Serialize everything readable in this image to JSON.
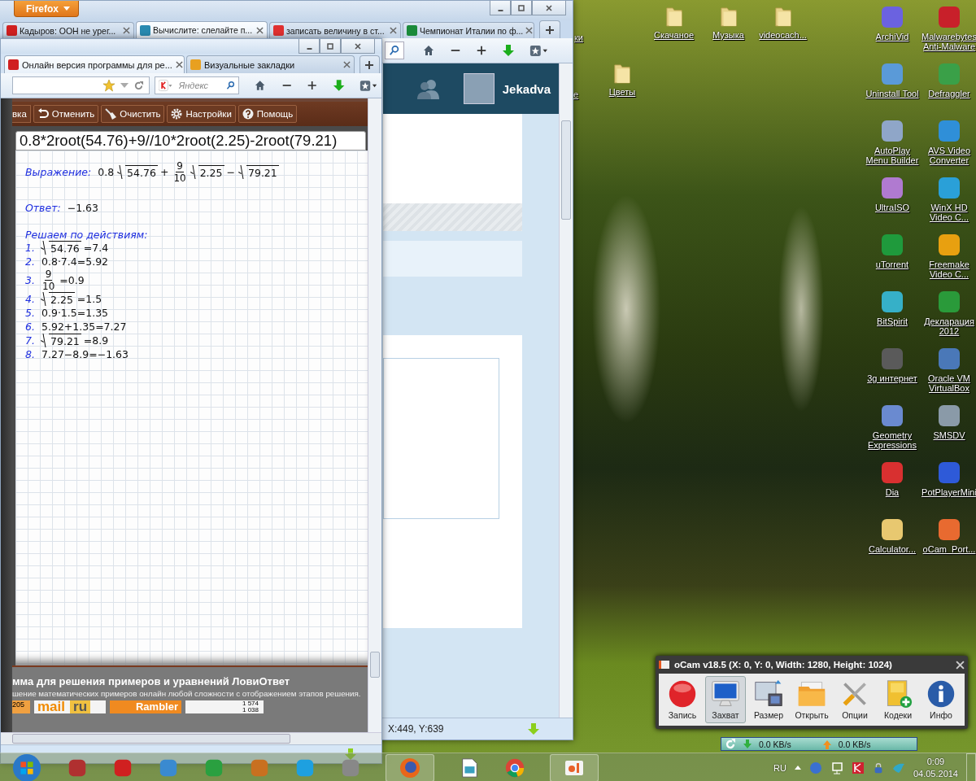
{
  "desktop": {
    "partial_labels": [
      "ки",
      "е"
    ],
    "folders": [
      {
        "label": "Скачаное"
      },
      {
        "label": "Музыка"
      },
      {
        "label": "videocach..."
      },
      {
        "label": "Цветы"
      }
    ],
    "shortcuts": [
      {
        "label": "ArchiVid",
        "color": "#6b62e0"
      },
      {
        "label": "Malwarebytes Anti-Malware",
        "color": "#c8202a"
      },
      {
        "label": "Uninstall Tool",
        "color": "#5a9ad8"
      },
      {
        "label": "Defraggler",
        "color": "#3aa048"
      },
      {
        "label": "AutoPlay Menu Builder",
        "color": "#8fa6c8"
      },
      {
        "label": "AVS Video Converter",
        "color": "#2f8fd8"
      },
      {
        "label": "UltraISO",
        "color": "#b07ad0"
      },
      {
        "label": "WinX HD Video C...",
        "color": "#2aa0d8"
      },
      {
        "label": "uTorrent",
        "color": "#1f9a3c"
      },
      {
        "label": "Freemake Video C...",
        "color": "#e8a010"
      },
      {
        "label": "BitSpirit",
        "color": "#36b0c8"
      },
      {
        "label": "Декларация 2012",
        "color": "#2a9a3a"
      },
      {
        "label": "3g интернет",
        "color": "#5a5a5a"
      },
      {
        "label": "Oracle VM VirtualBox",
        "color": "#4a78b8"
      },
      {
        "label": "Geometry Expressions",
        "color": "#6a8ad0"
      },
      {
        "label": "SMSDV",
        "color": "#8a9aa8"
      },
      {
        "label": "Dia",
        "color": "#d83030"
      },
      {
        "label": "PotPlayerMini",
        "color": "#2e5ad8"
      },
      {
        "label": "Calculator...",
        "color": "#e8c870"
      },
      {
        "label": "oCam_Port...",
        "color": "#e86a30"
      }
    ]
  },
  "back_window": {
    "menu_button": "Firefox",
    "tabs": [
      {
        "title": "Кадыров: ООН не урег...",
        "selected": false
      },
      {
        "title": "Вычислите: слелайте п...",
        "selected": true
      },
      {
        "title": "записать величину в ст...",
        "selected": false
      },
      {
        "title": "Чемпионат Италии по ф...",
        "selected": false
      }
    ],
    "page": {
      "username": "Jekadva"
    },
    "status": "X:449, Y:639"
  },
  "front_window": {
    "tabs": [
      {
        "title": "Онлайн версия программы для ре...",
        "selected": true
      },
      {
        "title": "Визуальные закладки",
        "selected": false
      }
    ],
    "search": {
      "placeholder": "Яндекс"
    },
    "toolbar": [
      {
        "label": "вка",
        "kind": "plain"
      },
      {
        "label": "Отменить",
        "kind": "undo"
      },
      {
        "label": "Очистить",
        "kind": "clear"
      },
      {
        "label": "Настройки",
        "kind": "settings"
      },
      {
        "label": "Помощь",
        "kind": "help"
      }
    ],
    "input": "0.8*2root(54.76)+9//10*2root(2.25)-2root(79.21)",
    "solution": {
      "expression_label": "Выражение:",
      "expression": [
        {
          "kind": "text",
          "text": "0.8"
        },
        {
          "kind": "sqrt",
          "text": "54.76"
        },
        {
          "kind": "text",
          "text": "+"
        },
        {
          "kind": "frac",
          "num": "9",
          "den": "10"
        },
        {
          "kind": "sqrt",
          "text": "2.25"
        },
        {
          "kind": "text",
          "text": "−"
        },
        {
          "kind": "sqrt",
          "text": "79.21"
        }
      ],
      "answer_label": "Ответ:",
      "answer": [
        {
          "kind": "text",
          "text": "−1.63"
        }
      ],
      "steps_label": "Решаем по действиям:",
      "steps": [
        {
          "number": "1.",
          "formula": [
            {
              "kind": "sqrt",
              "text": "54.76"
            },
            {
              "kind": "text",
              "text": "=7.4"
            }
          ]
        },
        {
          "number": "2.",
          "formula": [
            {
              "kind": "text",
              "text": "0.8·7.4=5.92"
            }
          ]
        },
        {
          "number": "3.",
          "formula": [
            {
              "kind": "frac",
              "num": "9",
              "den": "10"
            },
            {
              "kind": "text",
              "text": "=0.9"
            }
          ]
        },
        {
          "number": "4.",
          "formula": [
            {
              "kind": "sqrt",
              "text": "2.25"
            },
            {
              "kind": "text",
              "text": "=1.5"
            }
          ]
        },
        {
          "number": "5.",
          "formula": [
            {
              "kind": "text",
              "text": "0.9·1.5=1.35"
            }
          ]
        },
        {
          "number": "6.",
          "formula": [
            {
              "kind": "text",
              "text": "5.92+1.35=7.27"
            }
          ]
        },
        {
          "number": "7.",
          "formula": [
            {
              "kind": "sqrt",
              "text": "79.21"
            },
            {
              "kind": "text",
              "text": "=8.9"
            }
          ]
        },
        {
          "number": "8.",
          "formula": [
            {
              "kind": "text",
              "text": "7.27−8.9=−1.63"
            }
          ]
        }
      ]
    },
    "footer": {
      "title": "мма для решения примеров и уравнений ЛовиОтвет",
      "subtitle": "шение математических примеров онлайн любой сложности с отображением этапов решения.",
      "banners": [
        {
          "kind": "counter",
          "texts": [
            "205"
          ]
        },
        {
          "kind": "mail",
          "texts": [
            "mail",
            "ru"
          ]
        },
        {
          "kind": "rambler",
          "texts": [
            "Rambler"
          ]
        },
        {
          "kind": "stats",
          "texts": [
            "1 574",
            "1 038"
          ]
        }
      ]
    }
  },
  "ocam": {
    "title": "oCam v18.5 (X: 0, Y: 0, Width: 1280, Height: 1024)",
    "buttons": [
      {
        "label": "Запись",
        "kind": "record",
        "selected": false
      },
      {
        "label": "Захват",
        "kind": "capture",
        "selected": true
      },
      {
        "label": "Размер",
        "kind": "resize",
        "selected": false
      },
      {
        "label": "Открыть",
        "kind": "open",
        "selected": false
      },
      {
        "label": "Опции",
        "kind": "options",
        "selected": false
      },
      {
        "label": "Кодеки",
        "kind": "codecs",
        "selected": false
      },
      {
        "label": "Инфо",
        "kind": "info",
        "selected": false
      }
    ]
  },
  "net_meter": {
    "download": "0.0 KB/s",
    "upload": "0.0 KB/s"
  },
  "taskbar": {
    "language": "RU",
    "time": "0:09",
    "date": "04.05.2014"
  }
}
